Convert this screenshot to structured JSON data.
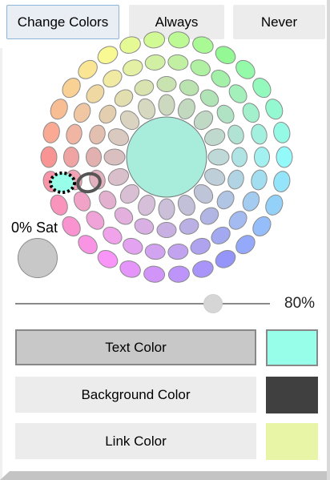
{
  "tabs": {
    "change_colors": "Change Colors",
    "always": "Always",
    "never": "Never"
  },
  "saturation": {
    "label": "0% Sat",
    "swatch_color": "#c8c8c8"
  },
  "brightness": {
    "value_text": "80%",
    "level": 0.8
  },
  "color_buttons": {
    "text": "Text Color",
    "background": "Background Color",
    "link": "Link Color"
  },
  "swatches": {
    "text_color": "#97ffe9",
    "background_color": "#404040",
    "link_color": "#e9f5a6"
  },
  "wheel": {
    "center_color": "#a8ecdc",
    "selected_icon": "dotted-circle-selection",
    "hover_icon": "ring-highlight"
  }
}
